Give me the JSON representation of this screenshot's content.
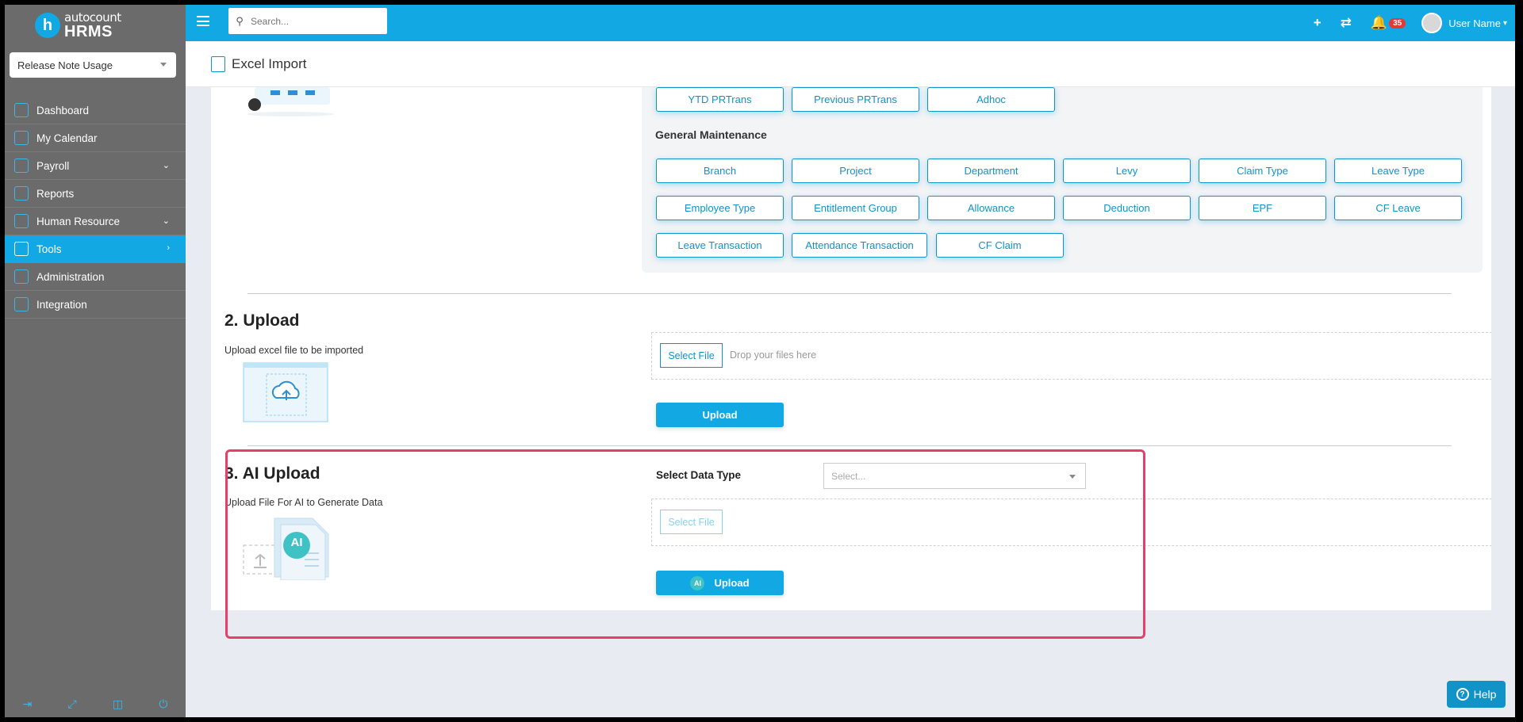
{
  "app": {
    "logo_top": "autocount",
    "logo_bottom": "HRMS",
    "logo_letter": "h"
  },
  "sidebar": {
    "company": "Release Note Usage",
    "items": [
      {
        "label": "Dashboard"
      },
      {
        "label": "My Calendar"
      },
      {
        "label": "Payroll"
      },
      {
        "label": "Reports"
      },
      {
        "label": "Human Resource"
      },
      {
        "label": "Tools"
      },
      {
        "label": "Administration"
      },
      {
        "label": "Integration"
      }
    ]
  },
  "topbar": {
    "search_placeholder": "Search...",
    "plus": "+",
    "sync": "⇄",
    "notification_count": "35",
    "user_name": "User Name"
  },
  "page": {
    "title": "Excel Import"
  },
  "section1": {
    "row0": [
      "YTD PRTrans",
      "Previous PRTrans",
      "Adhoc"
    ],
    "general_title": "General Maintenance",
    "row1": [
      "Branch",
      "Project",
      "Department",
      "Levy",
      "Claim Type",
      "Leave Type"
    ],
    "row2": [
      "Employee Type",
      "Entitlement Group",
      "Allowance",
      "Deduction",
      "EPF",
      "CF Leave"
    ],
    "row3": [
      "Leave Transaction",
      "Attendance Transaction",
      "CF Claim"
    ]
  },
  "section2": {
    "title": "2. Upload",
    "subtitle": "Upload excel file to be imported",
    "select_file": "Select File",
    "drop_text": "Drop your files here",
    "upload": "Upload"
  },
  "section3": {
    "title": "3. AI Upload",
    "subtitle": "Upload File For AI to Generate Data",
    "data_type_label": "Select Data Type",
    "data_type_placeholder": "Select...",
    "select_file": "Select File",
    "upload": "Upload",
    "ai_badge": "AI",
    "ai_illus": "AI"
  },
  "help": {
    "label": "Help",
    "icon_glyph": "?"
  },
  "colors": {
    "primary": "#11a8e4",
    "sidebar": "#6b6b6b",
    "highlight": "#e83e6c"
  }
}
